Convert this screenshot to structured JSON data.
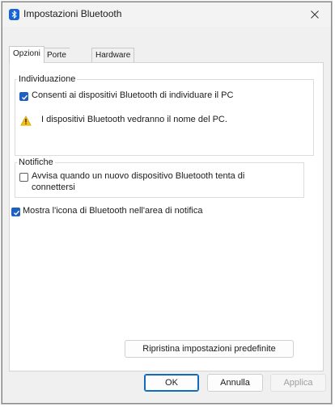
{
  "window": {
    "title": "Impostazioni Bluetooth",
    "icon": "bluetooth-icon",
    "close_glyph": "✕"
  },
  "tabs": [
    {
      "label": "Opzioni",
      "active": true
    },
    {
      "label": "Porte COM",
      "active": false
    },
    {
      "label": "Hardware",
      "active": false
    }
  ],
  "discovery": {
    "title": "Individuazione",
    "allow_label": "Consenti ai dispositivi Bluetooth di individuare il PC",
    "allow_checked": true,
    "warning_icon": "warning-icon",
    "warning_text": "I dispositivi Bluetooth vedranno il nome del PC."
  },
  "notifications": {
    "title": "Notifiche",
    "alert_label_line1": "Avvisa quando un nuovo dispositivo Bluetooth tenta di",
    "alert_label_line2": "connettersi",
    "alert_checked": false
  },
  "show_icon": {
    "label": "Mostra l'icona di Bluetooth nell'area di notifica",
    "checked": true
  },
  "restore_button": "Ripristina impostazioni predefinite",
  "footer": {
    "ok": "OK",
    "cancel": "Annulla",
    "apply": "Applica"
  },
  "colors": {
    "accent": "#1f5fbf",
    "bluetooth_blue": "#1565d8",
    "warning_yellow": "#f5c211"
  }
}
